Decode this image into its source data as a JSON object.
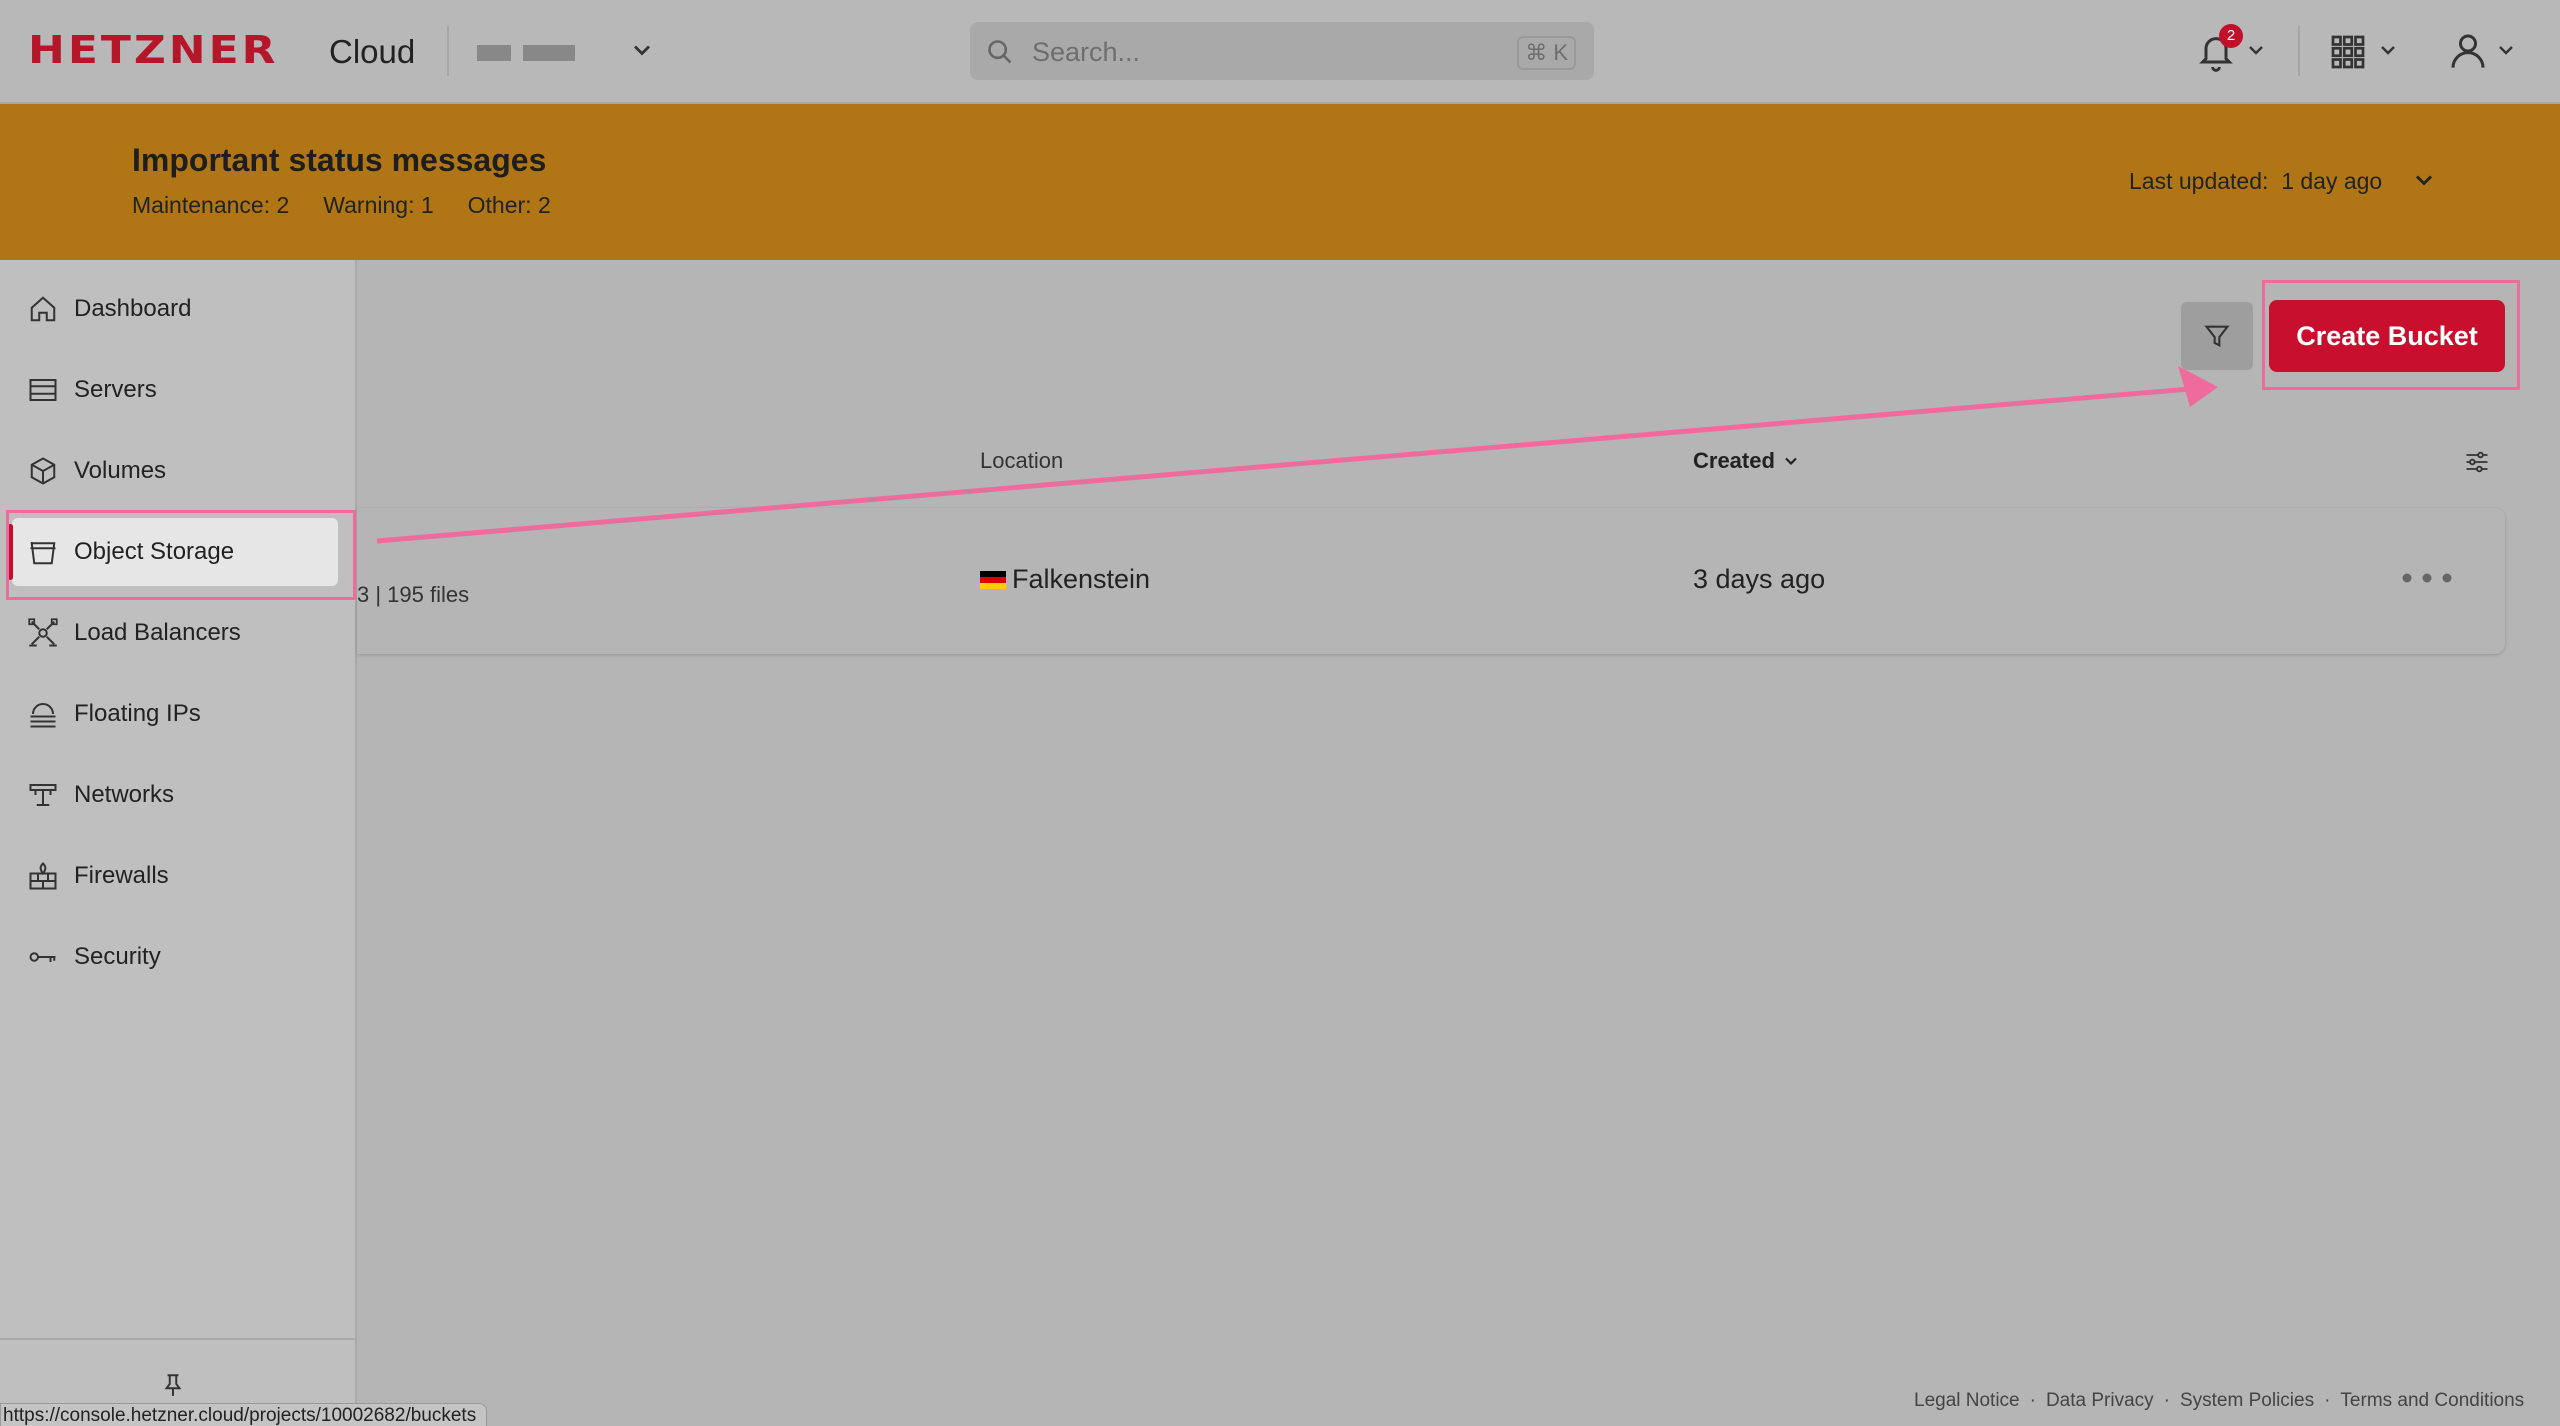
{
  "app": {
    "logo_text": "HETZNER",
    "product": "Cloud",
    "search_placeholder": "Search...",
    "search_shortcut": "⌘ K",
    "notification_count": "2"
  },
  "banner": {
    "title": "Important status messages",
    "maintenance_label": "Maintenance:",
    "maintenance_count": "2",
    "warning_label": "Warning:",
    "warning_count": "1",
    "other_label": "Other:",
    "other_count": "2",
    "updated_label": "Last updated:",
    "updated_value": "1 day ago"
  },
  "sidebar": {
    "items": [
      {
        "label": "Dashboard",
        "icon": "home-icon"
      },
      {
        "label": "Servers",
        "icon": "server-icon"
      },
      {
        "label": "Volumes",
        "icon": "cube-icon"
      },
      {
        "label": "Object Storage",
        "icon": "bucket-icon",
        "active": true
      },
      {
        "label": "Load Balancers",
        "icon": "load-balancer-icon"
      },
      {
        "label": "Floating IPs",
        "icon": "floating-ip-icon"
      },
      {
        "label": "Networks",
        "icon": "network-icon"
      },
      {
        "label": "Firewalls",
        "icon": "firewall-icon"
      },
      {
        "label": "Security",
        "icon": "key-icon"
      }
    ]
  },
  "main": {
    "create_button": "Create Bucket",
    "columns": {
      "location": "Location",
      "created": "Created"
    },
    "rows": [
      {
        "files": "3 | 195 files",
        "location": "Falkenstein",
        "created": "3 days ago"
      }
    ]
  },
  "footer": {
    "links": [
      "Legal Notice",
      "Data Privacy",
      "System Policies",
      "Terms and Conditions"
    ]
  },
  "status_url": "https://console.hetzner.cloud/projects/10002682/buckets",
  "colors": {
    "brand_red": "#c8102e",
    "banner": "#b07615",
    "highlight": "#f06b9d"
  }
}
